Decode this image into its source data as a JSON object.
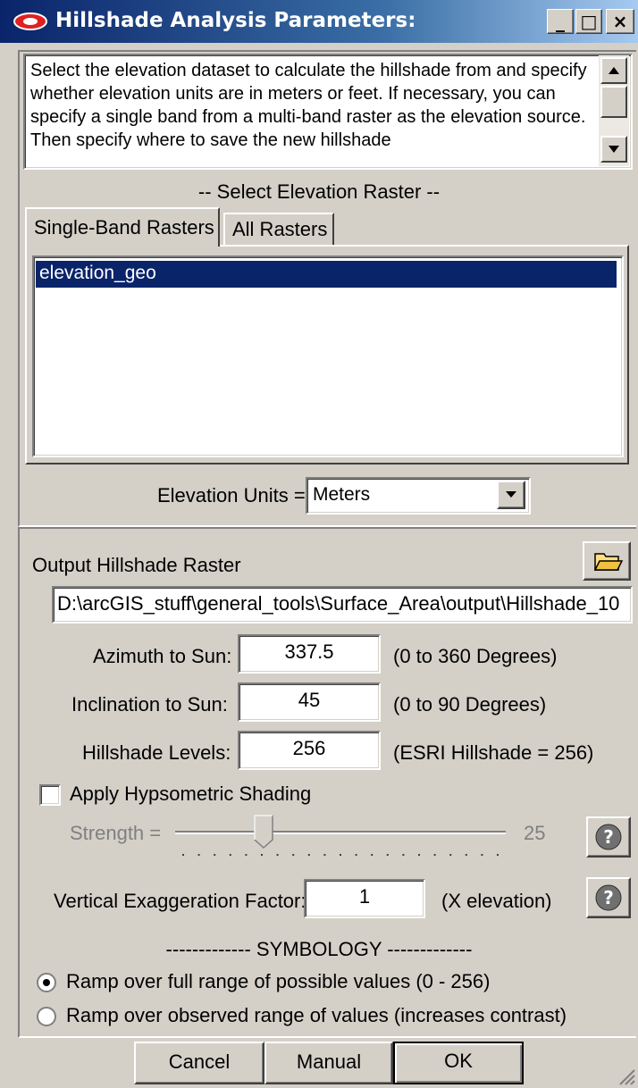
{
  "window": {
    "title": "Hillshade Analysis Parameters:",
    "buttons": {
      "minimize": "_",
      "maximize": "□",
      "close": "×"
    }
  },
  "description": {
    "text": "Select the elevation dataset to calculate the hillshade from and specify whether elevation units are in meters or feet. If necessary, you can specify a single band from a multi-band raster as the elevation source. Then specify where to save the new hillshade"
  },
  "select_raster": {
    "heading": "-- Select Elevation Raster --",
    "tabs": [
      "Single-Band Rasters",
      "All Rasters"
    ],
    "active_tab": 0,
    "items": [
      "elevation_geo"
    ],
    "selected_item": 0
  },
  "elevation_units": {
    "label": "Elevation Units =",
    "value": "Meters"
  },
  "output": {
    "label": "Output Hillshade Raster",
    "path": "D:\\arcGIS_stuff\\general_tools\\Surface_Area\\output\\Hillshade_10"
  },
  "params": [
    {
      "label": "Azimuth to Sun:",
      "value": "337.5",
      "hint": "(0 to 360 Degrees)"
    },
    {
      "label": "Inclination to Sun:",
      "value": "45",
      "hint": "(0 to 90 Degrees)"
    },
    {
      "label": "Hillshade Levels:",
      "value": "256",
      "hint": "(ESRI Hillshade = 256)"
    }
  ],
  "hypsometric": {
    "checkbox_label": "Apply Hypsometric Shading",
    "checked": false,
    "strength_label": "Strength =",
    "strength_value": "25",
    "help": "?"
  },
  "exaggeration": {
    "label": "Vertical Exaggeration Factor:",
    "value": "1",
    "hint": "(X elevation)",
    "help": "?"
  },
  "symbology": {
    "heading": "------------- SYMBOLOGY -------------",
    "options": [
      "Ramp over full range of possible values (0 - 256)",
      "Ramp over observed range of values (increases contrast)"
    ],
    "selected": 0
  },
  "footer": {
    "cancel": "Cancel",
    "manual": "Manual",
    "ok": "OK"
  },
  "colors": {
    "title_bar": "#0a246a",
    "face": "#d4d0c8",
    "selection": "#0a246a"
  }
}
